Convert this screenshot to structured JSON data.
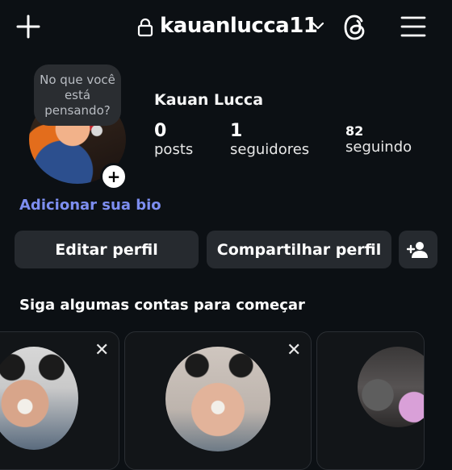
{
  "header": {
    "username": "kauanlucca11",
    "icons": [
      "add-icon",
      "lock-icon",
      "chevron-down-icon",
      "threads-icon",
      "menu-icon"
    ]
  },
  "profile": {
    "note_text": "No que você está pensando?",
    "display_name": "Kauan Lucca",
    "stats": {
      "posts_count": "0",
      "posts_label": "posts",
      "followers_count": "1",
      "followers_label": "seguidores",
      "following_count": "82",
      "following_label": "seguindo"
    },
    "bio_link": "Adicionar sua bio"
  },
  "actions": {
    "edit_label": "Editar perfil",
    "share_label": "Compartilhar perfil"
  },
  "suggestions": {
    "title": "Siga algumas contas para começar"
  },
  "colors": {
    "background": "#0c1014",
    "button": "#262a2f",
    "link": "#7d8ef0"
  }
}
